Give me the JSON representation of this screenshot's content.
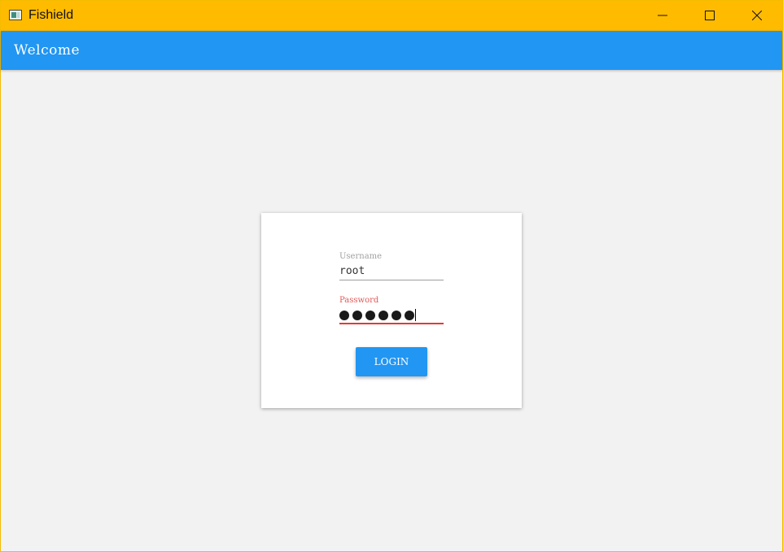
{
  "window": {
    "title": "Fishield",
    "controls": [
      "minimize-icon",
      "maximize-icon",
      "close-icon"
    ],
    "frame_color": "#ffbb00"
  },
  "appbar": {
    "title": "Welcome",
    "color": "#2196f3"
  },
  "login": {
    "username_label": "Username",
    "username_value": "root",
    "password_label": "Password",
    "password_masked_length": 6,
    "password_error_color": "#e53935",
    "button_label": "LOGIN"
  }
}
